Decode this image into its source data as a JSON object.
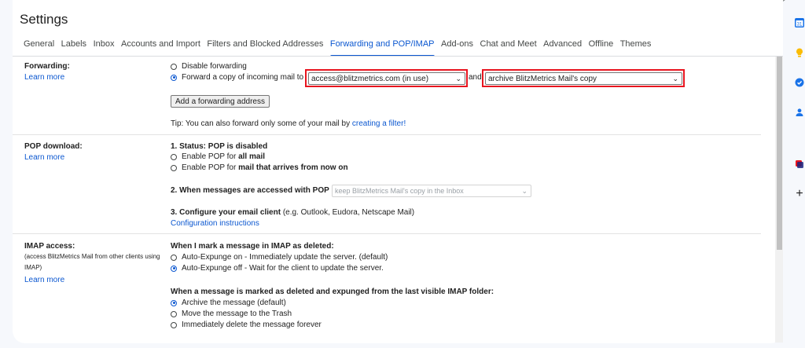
{
  "title": "Settings",
  "tabs": [
    "General",
    "Labels",
    "Inbox",
    "Accounts and Import",
    "Filters and Blocked Addresses",
    "Forwarding and POP/IMAP",
    "Add-ons",
    "Chat and Meet",
    "Advanced",
    "Offline",
    "Themes"
  ],
  "active_tab": "Forwarding and POP/IMAP",
  "forwarding": {
    "label": "Forwarding:",
    "learn_more": "Learn more",
    "disable": "Disable forwarding",
    "forward_prefix": "Forward a copy of incoming mail to",
    "address_value": "access@blitzmetrics.com (in use)",
    "and": "and",
    "action_value": "archive BlitzMetrics Mail's copy",
    "add_button": "Add a forwarding address",
    "tip_prefix": "Tip: You can also forward only some of your mail by",
    "tip_link": "creating a filter!"
  },
  "pop": {
    "label": "POP download:",
    "learn_more": "Learn more",
    "status_heading": "1. Status: POP is disabled",
    "enable_all_prefix": "Enable POP for",
    "enable_all_bold": "all mail",
    "enable_now_prefix": "Enable POP for",
    "enable_now_bold": "mail that arrives from now on",
    "accessed_heading": "2. When messages are accessed with POP",
    "accessed_value": "keep BlitzMetrics Mail's copy in the Inbox",
    "configure_heading": "3. Configure your email client",
    "configure_examples": "(e.g. Outlook, Eudora, Netscape Mail)",
    "configure_link": "Configuration instructions"
  },
  "imap": {
    "label": "IMAP access:",
    "sub_line1": "(access BlitzMetrics Mail from other clients using",
    "sub_line2": "IMAP)",
    "learn_more": "Learn more",
    "deleted_heading": "When I mark a message in IMAP as deleted:",
    "expunge_on": "Auto-Expunge on - Immediately update the server. (default)",
    "expunge_off": "Auto-Expunge off - Wait for the client to update the server.",
    "expunged_heading": "When a message is marked as deleted and expunged from the last visible IMAP folder:",
    "archive": "Archive the message (default)",
    "trash": "Move the message to the Trash",
    "delete_forever": "Immediately delete the message forever"
  },
  "side_panel": {
    "calendar_day": "31",
    "add": "+"
  },
  "colors": {
    "accent": "#0b57d0",
    "highlight": "#e8151f"
  }
}
